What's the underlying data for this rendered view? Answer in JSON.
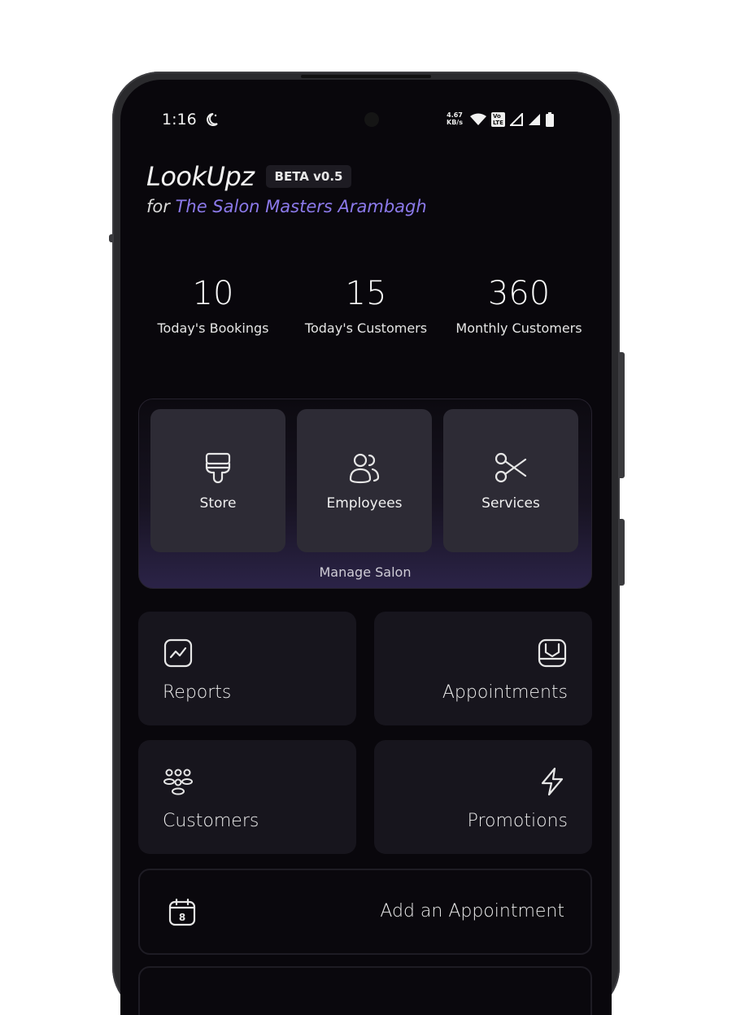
{
  "status_bar": {
    "time": "1:16",
    "net_speed_value": "4.67",
    "net_speed_unit": "KB/s",
    "volte_top": "Vo",
    "volte_bottom": "LTE"
  },
  "header": {
    "app_name": "LookUpz",
    "badge": "BETA v0.5",
    "subtitle_prefix": "for ",
    "salon_name": "The Salon Masters Arambagh"
  },
  "stats": [
    {
      "value": "10",
      "label": "Today's Bookings"
    },
    {
      "value": "15",
      "label": "Today's Customers"
    },
    {
      "value": "360",
      "label": "Monthly Customers"
    }
  ],
  "manage_salon": {
    "label": "Manage Salon",
    "tiles": [
      {
        "label": "Store",
        "icon": "store-icon"
      },
      {
        "label": "Employees",
        "icon": "employees-icon"
      },
      {
        "label": "Services",
        "icon": "scissors-icon"
      }
    ]
  },
  "cards": {
    "reports": {
      "label": "Reports",
      "icon": "chart-icon"
    },
    "appointments": {
      "label": "Appointments",
      "icon": "appointment-icon"
    },
    "customers": {
      "label": "Customers",
      "icon": "customers-icon"
    },
    "promotions": {
      "label": "Promotions",
      "icon": "lightning-icon"
    }
  },
  "add_appointment": {
    "label": "Add an Appointment",
    "icon": "calendar-icon",
    "calendar_day": "8"
  },
  "colors": {
    "background": "#09070c",
    "accent": "#8b79ea",
    "tile": "#2d2b35",
    "card": "#17151d"
  }
}
